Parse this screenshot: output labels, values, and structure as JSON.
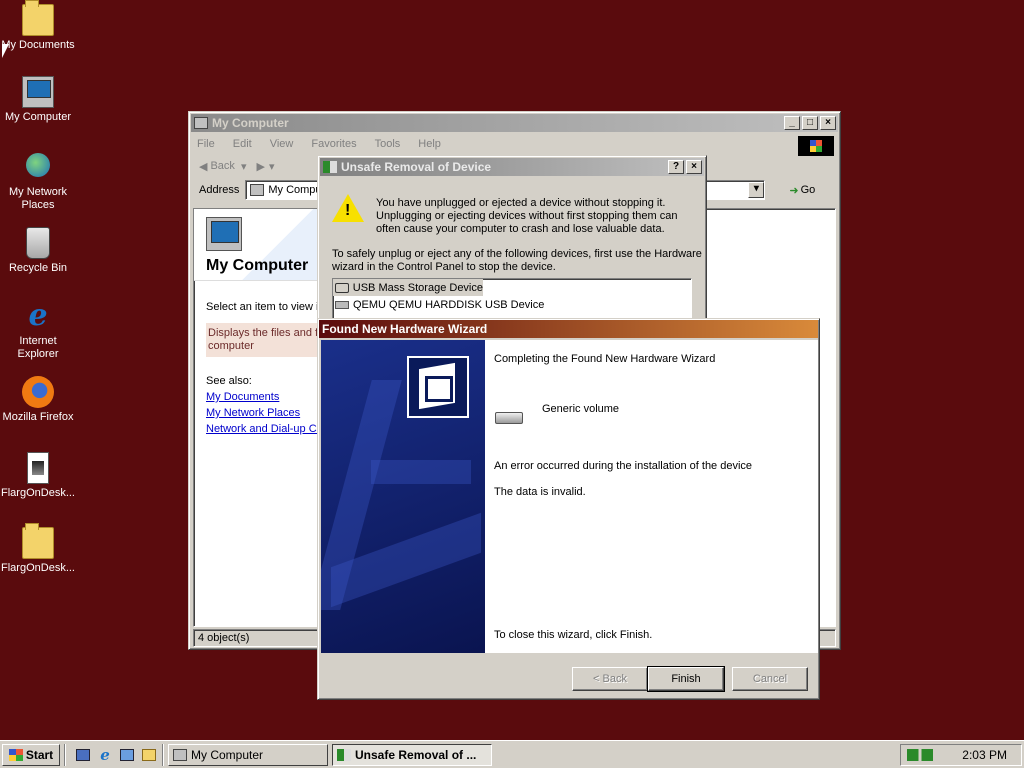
{
  "desktop": {
    "icons": [
      {
        "label": "My Documents"
      },
      {
        "label": "My Computer"
      },
      {
        "label": "My Network Places"
      },
      {
        "label": "Recycle Bin"
      },
      {
        "label": "Internet Explorer"
      },
      {
        "label": "Mozilla Firefox"
      },
      {
        "label": "FlargOnDesk..."
      },
      {
        "label": "FlargOnDesk..."
      }
    ]
  },
  "my_computer": {
    "title": "My Computer",
    "menu": [
      "File",
      "Edit",
      "View",
      "Favorites",
      "Tools",
      "Help"
    ],
    "toolbar": {
      "back": "Back"
    },
    "address_label": "Address",
    "address_value": "My Compu",
    "go_label": "Go",
    "banner_title": "My Computer",
    "select_hint": "Select an item to view it",
    "description": "Displays the files and fo\ncomputer",
    "see_also": "See also:",
    "links": [
      "My Documents",
      "My Network Places",
      "Network and Dial-up Co"
    ],
    "status": "4 object(s)"
  },
  "unsafe_dialog": {
    "title": "Unsafe Removal of Device",
    "help": "?",
    "message": "You have unplugged or ejected a device without stopping it. Unplugging or ejecting devices without first stopping them can often cause your computer to crash and lose valuable data.",
    "instructions": "To safely unplug or eject any of the following devices, first use the Hardware wizard in the Control Panel to stop the device.",
    "devices": [
      "USB Mass Storage Device",
      "QEMU QEMU HARDDISK USB Device"
    ]
  },
  "wizard": {
    "title": "Found New Hardware Wizard",
    "heading": "Completing the Found New Hardware Wizard",
    "device": "Generic volume",
    "error": "An error occurred during the installation of the device",
    "error_detail": "The data is invalid.",
    "close_hint": "To close this wizard, click Finish.",
    "buttons": {
      "back": "< Back",
      "finish": "Finish",
      "cancel": "Cancel"
    }
  },
  "taskbar": {
    "start": "Start",
    "tasks": [
      "My Computer",
      "Unsafe Removal of ..."
    ],
    "clock": "2:03 PM"
  }
}
